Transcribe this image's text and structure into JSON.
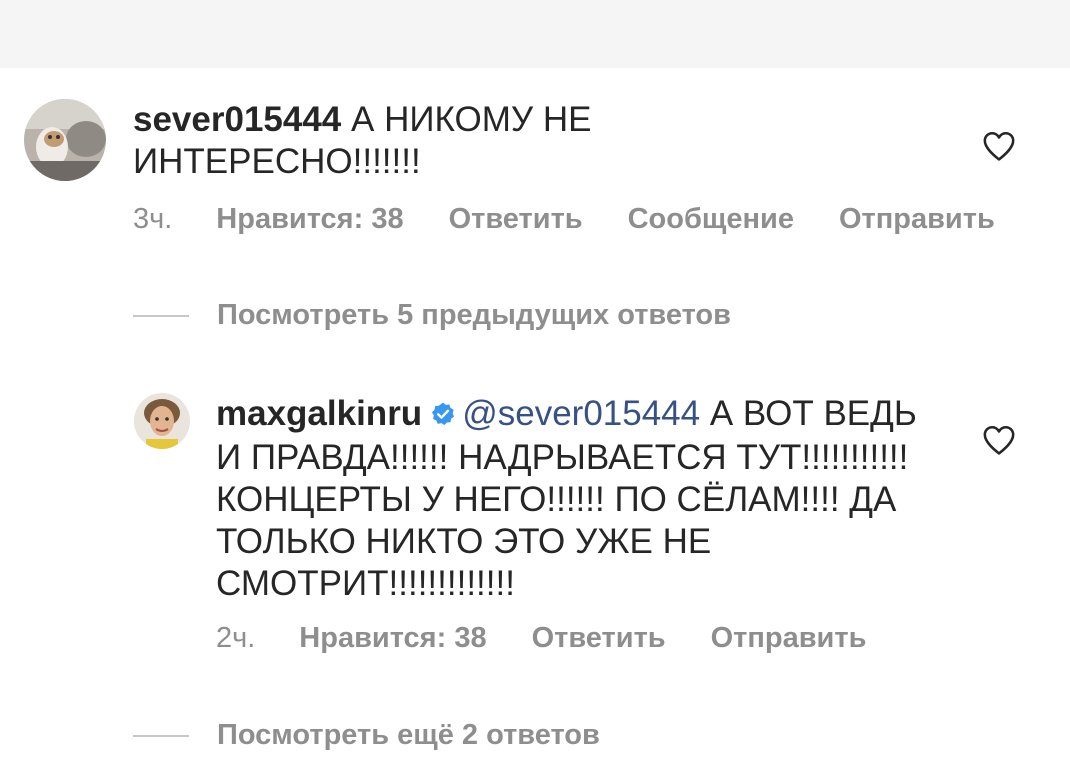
{
  "comments": [
    {
      "username": "sever015444",
      "text": "А НИКОМУ НЕ ИНТЕРЕСНО!!!!!!!",
      "time": "3ч.",
      "likes": "Нравится: 38",
      "reply": "Ответить",
      "message": "Сообщение",
      "send": "Отправить"
    },
    {
      "username": "maxgalkinru",
      "mention": "@sever015444",
      "text": "А ВОТ ВЕДЬ И ПРАВДА!!!!!! НАДРЫВАЕТСЯ ТУТ!!!!!!!!!!! КОНЦЕРТЫ У НЕГО!!!!!! ПО СЁЛАМ!!!! ДА ТОЛЬКО НИКТО ЭТО УЖЕ НЕ СМОТРИТ!!!!!!!!!!!!!",
      "time": "2ч.",
      "likes": "Нравится: 38",
      "reply": "Ответить",
      "send": "Отправить"
    }
  ],
  "view_previous_replies": "Посмотреть 5 предыдущих ответов",
  "view_more_replies": "Посмотреть ещё 2 ответов",
  "colors": {
    "text": "#262626",
    "secondary": "#8e8e8e",
    "mention": "#385185",
    "verified": "#3897f0",
    "top_bar": "#f5f5f5"
  },
  "icons": {
    "like": "heart-icon",
    "verified": "verified-badge-icon"
  }
}
